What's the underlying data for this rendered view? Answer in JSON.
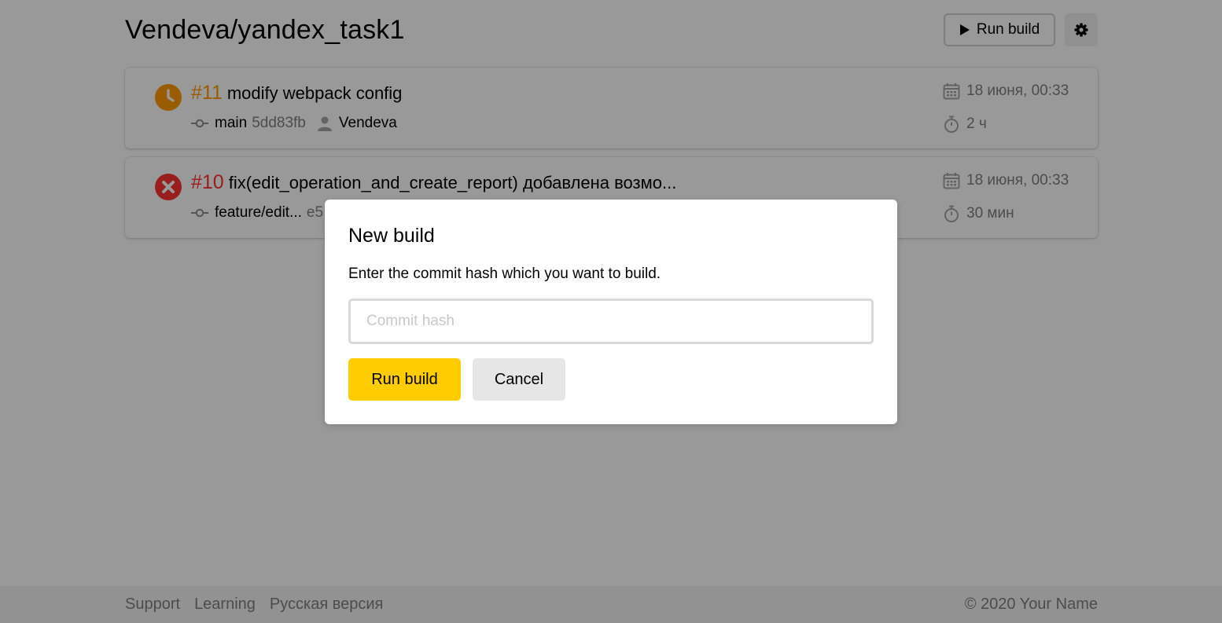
{
  "header": {
    "repo_title": "Vendeva/yandex_task1",
    "run_build_label": "Run build"
  },
  "builds": [
    {
      "status": "pending",
      "number": "#11",
      "message": "modify webpack config",
      "branch": "main",
      "hash": "5dd83fb",
      "author": "Vendeva",
      "date": "18 июня, 00:33",
      "duration": "2 ч"
    },
    {
      "status": "fail",
      "number": "#10",
      "message": "fix(edit_operation_and_create_report) добавлена возмо...",
      "branch": "feature/edit...",
      "hash": "e5",
      "author": "",
      "date": "18 июня, 00:33",
      "duration": "30 мин"
    }
  ],
  "footer": {
    "links": [
      "Support",
      "Learning",
      "Русская версия"
    ],
    "copyright": "© 2020 Your Name"
  },
  "modal": {
    "title": "New build",
    "description": "Enter the commit hash which you want to build.",
    "input_placeholder": "Commit hash",
    "input_value": "",
    "run_label": "Run build",
    "cancel_label": "Cancel"
  },
  "colors": {
    "accent": "#ffcc00",
    "pending": "#ff9a00",
    "fail": "#ff3333",
    "secondary_text": "#7f7f7f"
  }
}
